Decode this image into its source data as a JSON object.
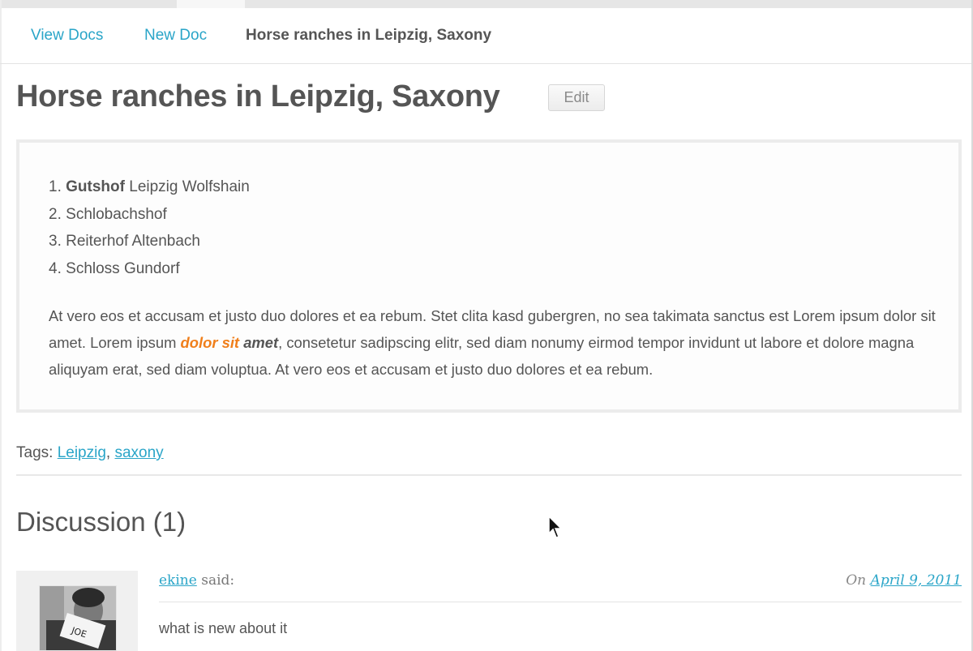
{
  "nav": {
    "view_docs": "View Docs",
    "new_doc": "New Doc",
    "current": "Horse ranches in Leipzig, Saxony"
  },
  "document": {
    "title": "Horse ranches in Leipzig, Saxony",
    "edit_label": "Edit",
    "list": [
      {
        "number": "1.",
        "bold": "Gutshof",
        "text": " Leipzig Wolfshain"
      },
      {
        "number": "2.",
        "bold": "",
        "text": "Schlobachshof"
      },
      {
        "number": "3.",
        "bold": "",
        "text": "Reiterhof Altenbach"
      },
      {
        "number": "4.",
        "bold": "",
        "text": "Schloss Gundorf"
      }
    ],
    "paragraph": {
      "part1": "At vero eos et accusam et justo duo dolores et ea rebum. Stet clita kasd gubergren, no sea takimata sanctus est Lorem ipsum dolor sit amet. Lorem ipsum ",
      "highlight_orange": "dolor sit",
      "highlight_space": " ",
      "highlight_bold": "amet",
      "part2": ", consetetur sadipscing elitr, sed diam nonumy eirmod tempor invidunt ut labore et dolore magna aliquyam erat, sed diam voluptua. At vero eos et accusam et justo duo dolores et ea rebum."
    }
  },
  "tags": {
    "label": "Tags: ",
    "items": [
      "Leipzig",
      "saxony"
    ],
    "separator": ", "
  },
  "discussion": {
    "title": "Discussion (1)",
    "comments": [
      {
        "author": "ekine",
        "said": " said:",
        "date_prefix": "On ",
        "date": "April 9, 2011",
        "text": "what is new about it",
        "avatar_card_text": "JOE"
      }
    ]
  },
  "colors": {
    "link": "#2aa5c8",
    "text": "#555555",
    "highlight": "#f07f1b"
  },
  "icons": {
    "cursor": "mouse-pointer-icon"
  }
}
